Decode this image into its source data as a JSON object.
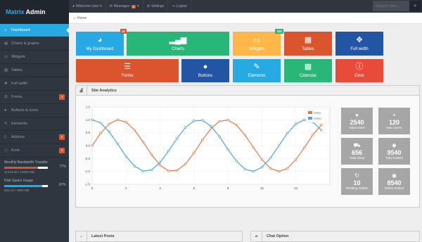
{
  "app": {
    "logo_part1": "Matrix",
    "logo_part2": "Admin"
  },
  "topnav": [
    {
      "icon": "user-icon",
      "label": "Welcome User ▾"
    },
    {
      "icon": "envelope-icon",
      "label": "Messages",
      "badge": "5"
    },
    {
      "icon": "gear-icon",
      "label": "Settings"
    },
    {
      "icon": "logout-icon",
      "label": "Logout"
    }
  ],
  "search": {
    "placeholder": "Search here..."
  },
  "breadcrumb": {
    "home": "Home"
  },
  "sidebar": {
    "items": [
      {
        "label": "Dashboard",
        "icon": "home-icon"
      },
      {
        "label": "Charts &amp; graphs",
        "icon": "chart-icon"
      },
      {
        "label": "Widgets",
        "icon": "inbox-icon"
      },
      {
        "label": "Tables",
        "icon": "table-icon"
      },
      {
        "label": "Full width",
        "icon": "fullscreen-icon"
      },
      {
        "label": "Forms",
        "icon": "list-icon",
        "badge": "3"
      },
      {
        "label": "Buttons &amp; icons",
        "icon": "tint-icon"
      },
      {
        "label": "Elements",
        "icon": "pencil-icon"
      },
      {
        "label": "Addons",
        "icon": "file-icon",
        "badge": "5"
      },
      {
        "label": "Error",
        "icon": "info-icon",
        "badge": "4"
      }
    ],
    "stats": [
      {
        "label": "Monthly Bandwidth Transfer",
        "value": "21419.94 / 14000 MB",
        "percent": "77%",
        "level": 0.77,
        "color": "#da542e"
      },
      {
        "label": "Disk Space Usage",
        "value": "604.44 / 4000 MB",
        "percent": "87%",
        "level": 0.87,
        "color": "#27a9e3"
      }
    ]
  },
  "colors": {
    "blue": "#27a9e3",
    "green": "#28b779",
    "orange": "#ffb848",
    "red": "#da542e",
    "navy": "#2255a4",
    "crimson": "#e94b3b",
    "badge_green": "#28b779",
    "series_sin": "#e37a4a",
    "series_cos": "#4aa6dc"
  },
  "tiles": [
    {
      "label": "My Dashboard",
      "icon": "dashboard-icon",
      "glyph": "◕",
      "badge": "20",
      "color": "#27a9e3"
    },
    {
      "label": "Charts",
      "icon": "signal-icon",
      "glyph": "▂▄▆",
      "color": "#28b779"
    },
    {
      "label": "Widgets",
      "icon": "inbox-icon",
      "glyph": "▭",
      "badge": "101",
      "color": "#ffb848"
    },
    {
      "label": "Tables",
      "icon": "grid-icon",
      "glyph": "▦",
      "color": "#da542e"
    },
    {
      "label": "Full width",
      "icon": "fullscreen-icon",
      "glyph": "✥",
      "color": "#2255a4"
    },
    {
      "label": "Forms",
      "icon": "list-icon",
      "glyph": "☰",
      "color": "#da542e"
    },
    {
      "label": "Buttons",
      "icon": "tint-icon",
      "glyph": "●",
      "color": "#2255a4"
    },
    {
      "label": "Elements",
      "icon": "pencil-icon",
      "glyph": "✎",
      "color": "#27a9e3"
    },
    {
      "label": "Calendar",
      "icon": "calendar-icon",
      "glyph": "▦",
      "color": "#28b779"
    },
    {
      "label": "Error",
      "icon": "info-icon",
      "glyph": "ⓘ",
      "color": "#e94b3b"
    }
  ],
  "analytics": {
    "title": "Site Analytics",
    "stats": [
      {
        "value": "2540",
        "label": "Total Users",
        "icon": "user-icon",
        "glyph": "●"
      },
      {
        "value": "120",
        "label": "New Users",
        "icon": "plus-icon",
        "glyph": "+"
      },
      {
        "value": "656",
        "label": "Total Shop",
        "icon": "cart-icon",
        "glyph": "⛟"
      },
      {
        "value": "9540",
        "label": "Total Orders",
        "icon": "tag-icon",
        "glyph": "◆"
      },
      {
        "value": "10",
        "label": "Pending Orders",
        "icon": "repeat-icon",
        "glyph": "↻"
      },
      {
        "value": "8540",
        "label": "Online Orders",
        "icon": "globe-icon",
        "glyph": "◉"
      }
    ]
  },
  "chart_data": {
    "type": "line",
    "xlim": [
      0,
      14
    ],
    "ylim": [
      -1.5,
      1.5
    ],
    "xticks": [
      0,
      2,
      4,
      6,
      8,
      10,
      12
    ],
    "yticks": [
      1.5,
      1.0,
      0.5,
      0.0,
      -0.5,
      -1.0,
      -1.5
    ],
    "ytick_labels": [
      "1.5",
      "1.0",
      "0.5",
      "0.0",
      "-0.5",
      "-1.0",
      "-1.5"
    ],
    "grid": true,
    "legend_position": "top-right",
    "series": [
      {
        "name": "sin(x)",
        "x": [
          0,
          0.5,
          1,
          1.5,
          2,
          2.5,
          3,
          3.5,
          4,
          4.5,
          5,
          5.5,
          6,
          6.5,
          7,
          7.5,
          8,
          8.5,
          9,
          9.5,
          10,
          10.5,
          11,
          11.5,
          12,
          12.5,
          13,
          13.5
        ],
        "y": [
          0.0,
          0.48,
          0.84,
          1.0,
          0.91,
          0.6,
          0.14,
          -0.35,
          -0.76,
          -0.98,
          -0.96,
          -0.71,
          -0.28,
          0.22,
          0.66,
          0.94,
          0.99,
          0.8,
          0.41,
          -0.08,
          -0.54,
          -0.88,
          -1.0,
          -0.88,
          -0.54,
          -0.07,
          0.42,
          0.8
        ]
      },
      {
        "name": "cos(x)",
        "x": [
          0,
          0.5,
          1,
          1.5,
          2,
          2.5,
          3,
          3.5,
          4,
          4.5,
          5,
          5.5,
          6,
          6.5,
          7,
          7.5,
          8,
          8.5,
          9,
          9.5,
          10,
          10.5,
          11,
          11.5,
          12,
          12.5,
          13,
          13.5
        ],
        "y": [
          1.0,
          0.88,
          0.54,
          0.07,
          -0.42,
          -0.8,
          -0.99,
          -0.94,
          -0.65,
          -0.21,
          0.28,
          0.71,
          0.96,
          0.98,
          0.75,
          0.35,
          -0.15,
          -0.6,
          -0.91,
          -1.0,
          -0.84,
          -0.48,
          0.0,
          0.48,
          0.84,
          1.0,
          0.91,
          0.6
        ]
      }
    ]
  },
  "bottom": {
    "left_title": "Latest Posts",
    "right_title": "Chat Option"
  }
}
